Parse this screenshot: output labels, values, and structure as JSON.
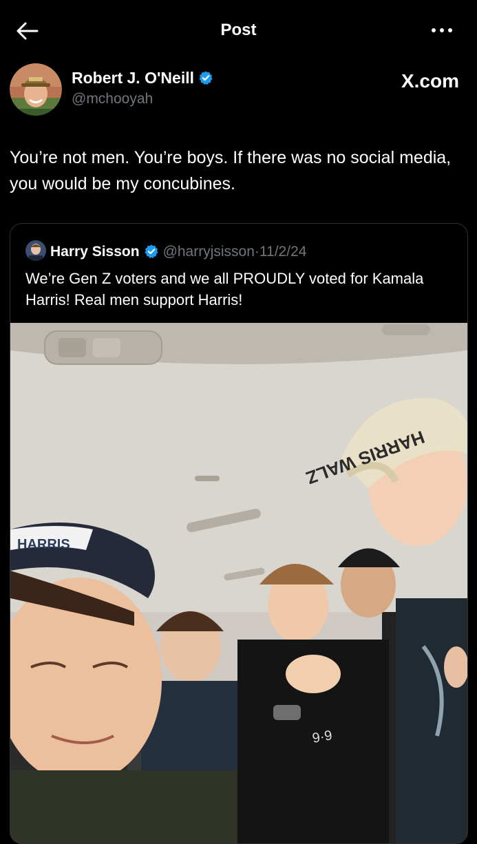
{
  "header": {
    "back_icon": "arrow-left-icon",
    "title": "Post",
    "more_icon": "more-horizontal-icon"
  },
  "post": {
    "author": {
      "name": "Robert J. O'Neill",
      "handle": "@mchooyah",
      "verified": true
    },
    "source_label": "X.com",
    "text": "You’re not men. You’re boys. If there was no social media, you would be my concubines."
  },
  "quote": {
    "author": {
      "name": "Harry Sisson",
      "handle": "@harryjsisson",
      "verified": true
    },
    "separator": "·",
    "date": "11/2/24",
    "text": "We’re Gen Z voters and we all PROUDLY voted for Kamala Harris! Real men support Harris!",
    "photo": {
      "cap_text_right": "HARRIS WALZ",
      "cap_text_left": "HARRIS"
    }
  },
  "colors": {
    "background": "#000000",
    "text_primary": "#e7e9ea",
    "text_secondary": "#71767b",
    "verified_blue": "#1d9bf0",
    "border": "#2f3336"
  }
}
